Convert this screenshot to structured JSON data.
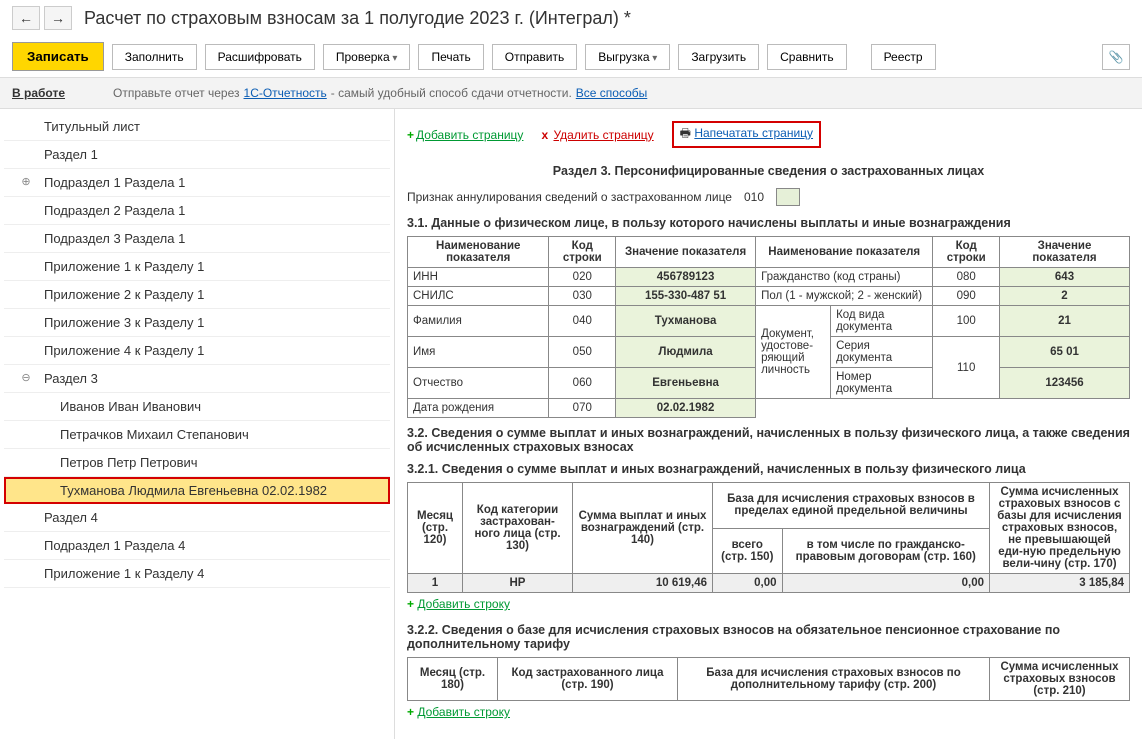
{
  "header": {
    "title": "Расчет по страховым взносам за 1 полугодие 2023 г. (Интеграл) *"
  },
  "toolbar": {
    "write": "Записать",
    "fill": "Заполнить",
    "decrypt": "Расшифровать",
    "check": "Проверка",
    "print": "Печать",
    "send": "Отправить",
    "export": "Выгрузка",
    "load": "Загрузить",
    "compare": "Сравнить",
    "registry": "Реестр"
  },
  "status": {
    "in_work": "В работе",
    "info_prefix": "Отправьте отчет через",
    "link1": "1С-Отчетность",
    "info_mid": " - самый удобный способ сдачи отчетности.",
    "link2": "Все способы"
  },
  "sidebar": {
    "items": [
      "Титульный лист",
      "Раздел 1",
      "Подраздел 1 Раздела 1",
      "Подраздел 2 Раздела 1",
      "Подраздел 3 Раздела 1",
      "Приложение 1 к Разделу 1",
      "Приложение 2 к Разделу 1",
      "Приложение 3 к Разделу 1",
      "Приложение 4 к Разделу 1",
      "Раздел 3",
      "Иванов Иван Иванович",
      "Петрачков Михаил Степанович",
      "Петров Петр Петрович",
      "Тухманова Людмила Евгеньевна 02.02.1982",
      "Раздел 4",
      "Подраздел 1 Раздела 4",
      "Приложение 1 к Разделу 4"
    ]
  },
  "page_actions": {
    "add": "Добавить страницу",
    "del": "Удалить страницу",
    "print": "Напечатать страницу"
  },
  "section3": {
    "title": "Раздел 3. Персонифицированные сведения о застрахованных лицах",
    "annul_label": "Признак аннулирования сведений о застрахованном лице",
    "annul_code": "010",
    "h31": "3.1. Данные о физическом лице, в пользу которого начислены выплаты и иные вознаграждения",
    "t31": {
      "h_name": "Наименование показателя",
      "h_code": "Код строки",
      "h_val": "Значение показателя",
      "inn": "ИНН",
      "inn_c": "020",
      "inn_v": "456789123",
      "snils": "СНИЛС",
      "snils_c": "030",
      "snils_v": "155-330-487 51",
      "fam": "Фамилия",
      "fam_c": "040",
      "fam_v": "Тухманова",
      "name": "Имя",
      "name_c": "050",
      "name_v": "Людмила",
      "patr": "Отчество",
      "patr_c": "060",
      "patr_v": "Евгеньевна",
      "dob": "Дата рождения",
      "dob_c": "070",
      "dob_v": "02.02.1982",
      "citiz": "Гражданство (код страны)",
      "citiz_c": "080",
      "citiz_v": "643",
      "sex": "Пол (1 - мужской; 2 - женский)",
      "sex_c": "090",
      "sex_v": "2",
      "doc_label": "Документ, удостове-ряющий личность",
      "doc_kind": "Код вида документа",
      "doc_kind_c": "100",
      "doc_kind_v": "21",
      "doc_ser": "Серия документа",
      "doc_ser_v": "65 01",
      "doc_num": "Номер документа",
      "doc_num_c": "110",
      "doc_num_v": "123456"
    },
    "h32": "3.2. Сведения о сумме выплат и иных вознаграждений, начисленных в пользу физического лица, а также сведения об исчисленных страховых взносах",
    "h321": "3.2.1. Сведения о сумме выплат и иных вознаграждений, начисленных в пользу физического лица",
    "t321": {
      "c1": "Месяц (стр. 120)",
      "c2": "Код категории застрахован-ного лица (стр. 130)",
      "c3": "Сумма выплат и иных вознаграждений (стр. 140)",
      "c4_top": "База для исчисления страховых взносов в пределах единой предельной величины",
      "c4a": "всего (стр. 150)",
      "c4b": "в том числе по гражданско-правовым договорам (стр. 160)",
      "c5": "Сумма исчисленных страховых взносов с базы для исчисления страховых взносов, не превышающей еди-ную предельную вели-чину (стр. 170)",
      "r1": {
        "m": "1",
        "cat": "НР",
        "sum": "10 619,46",
        "base_all": "0,00",
        "base_gpd": "0,00",
        "fee": "3 185,84"
      }
    },
    "add_row": "Добавить строку",
    "h322": "3.2.2. Сведения о базе для исчисления страховых взносов на обязательное пенсионное страхование по дополнительному тарифу",
    "t322": {
      "c1": "Месяц (стр. 180)",
      "c2": "Код застрахованного лица (стр. 190)",
      "c3": "База для исчисления страховых взносов по дополнительному тарифу (стр. 200)",
      "c4": "Сумма исчисленных страховых взносов (стр. 210)"
    }
  }
}
